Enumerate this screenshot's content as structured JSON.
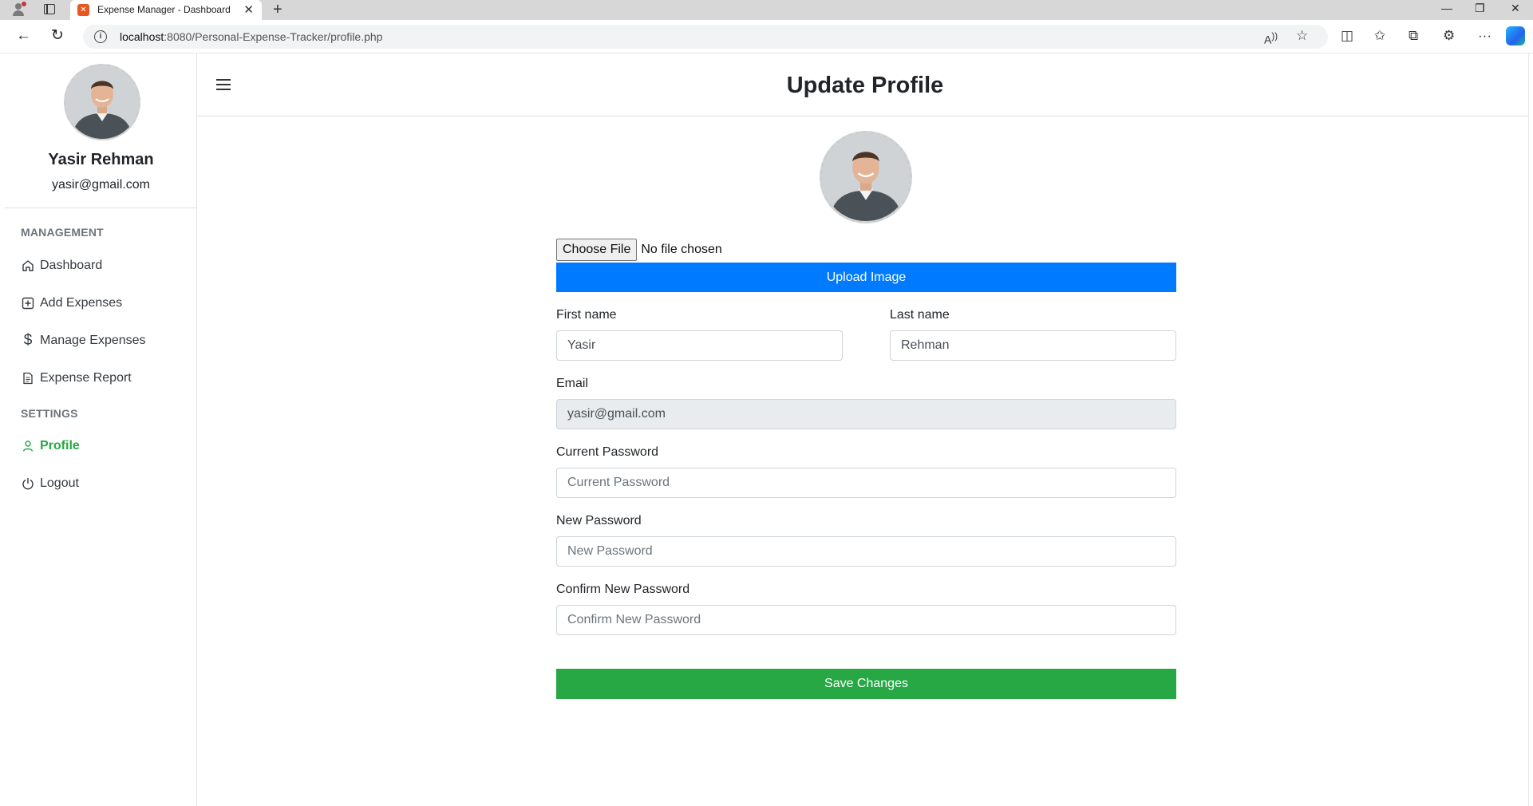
{
  "browser": {
    "tab_title": "Expense Manager - Dashboard",
    "url_host": "localhost",
    "url_rest": ":8080/Personal-Expense-Tracker/profile.php"
  },
  "sidebar": {
    "user_name": "Yasir Rehman",
    "user_email": "yasir@gmail.com",
    "management_heading": "MANAGEMENT",
    "settings_heading": "SETTINGS",
    "items": [
      {
        "label": "Dashboard",
        "icon": "home-icon"
      },
      {
        "label": "Add Expenses",
        "icon": "plus-square-icon"
      },
      {
        "label": "Manage Expenses",
        "icon": "dollar-icon"
      },
      {
        "label": "Expense Report",
        "icon": "document-icon"
      },
      {
        "label": "Profile",
        "icon": "user-icon",
        "active": true
      },
      {
        "label": "Logout",
        "icon": "power-icon"
      }
    ]
  },
  "main": {
    "title": "Update Profile",
    "file_button": "Choose File",
    "file_status": "No file chosen",
    "upload_button": "Upload Image",
    "first_name_label": "First name",
    "first_name_value": "Yasir",
    "last_name_label": "Last name",
    "last_name_value": "Rehman",
    "email_label": "Email",
    "email_value": "yasir@gmail.com",
    "current_password_label": "Current Password",
    "current_password_placeholder": "Current Password",
    "new_password_label": "New Password",
    "new_password_placeholder": "New Password",
    "confirm_password_label": "Confirm New Password",
    "confirm_password_placeholder": "Confirm New Password",
    "save_button": "Save Changes"
  },
  "colors": {
    "primary": "#007bff",
    "success": "#28a745",
    "muted": "#6c757d"
  }
}
